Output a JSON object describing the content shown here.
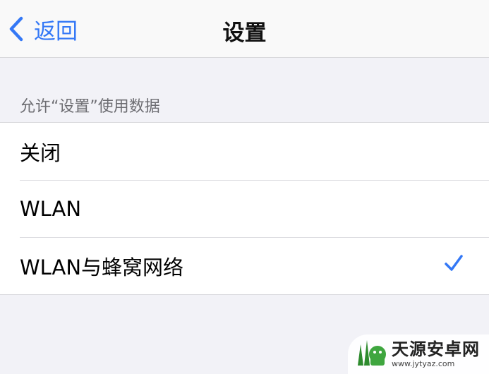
{
  "navbar": {
    "back_label": "返回",
    "back_icon": "chevron-left-icon",
    "title": "设置"
  },
  "section": {
    "header": "允许“设置”使用数据"
  },
  "options": [
    {
      "label": "关闭",
      "selected": false
    },
    {
      "label": "WLAN",
      "selected": false
    },
    {
      "label": "WLAN与蜂窝网络",
      "selected": true
    }
  ],
  "watermark": {
    "name": "天源安卓网",
    "url": "www.jytyaz.com"
  },
  "colors": {
    "accent": "#3478f6",
    "background": "#f2f2f7",
    "cell": "#ffffff",
    "secondary_text": "#6d6d72"
  }
}
